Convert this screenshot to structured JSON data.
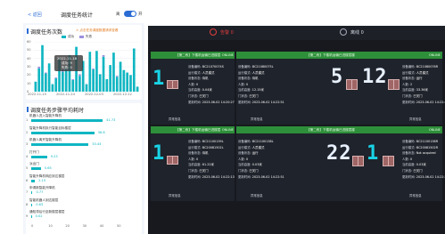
{
  "phone": {
    "back_label": "< 返回",
    "title": "调度任务统计",
    "toggle_on_label": "离",
    "toggle_off_label": "开",
    "section1": {
      "title": "调度任务次数",
      "note": "⚠ 点击任务调度数据请求查看",
      "legend": [
        {
          "label": "成功",
          "color": "#0fb6c2"
        },
        {
          "label": "失败",
          "color": "#9b8fe0"
        }
      ],
      "tooltip": {
        "date": "2022-11-18",
        "success": "成功: 9",
        "fail": "失败: 0"
      }
    },
    "section2": {
      "title": "调度任务步骤平均耗时"
    },
    "y_axis": [
      "60",
      "50",
      "40",
      "30",
      "20",
      "10",
      "0"
    ]
  },
  "chart_data": [
    {
      "type": "bar",
      "title": "调度任务次数",
      "x_tick_labels": [
        "2022-11-15",
        "2022-11-24",
        "2022-12-03",
        "2022-12-12"
      ],
      "ylim": [
        0,
        60
      ],
      "series": [
        {
          "name": "成功",
          "values": [
            12,
            28,
            56,
            22,
            34,
            9,
            16,
            40,
            24,
            30,
            44,
            14,
            54,
            19,
            37,
            9,
            48,
            27,
            49,
            21,
            42,
            15,
            32,
            47,
            18,
            36,
            26,
            23,
            20,
            52,
            6
          ]
        },
        {
          "name": "失败",
          "values": [
            0,
            2,
            0,
            1,
            0,
            0,
            1,
            0,
            3,
            0,
            0,
            1,
            0,
            2,
            0,
            0,
            0,
            1,
            0,
            0,
            2,
            0,
            0,
            0,
            1,
            0,
            0,
            0,
            0,
            0,
            0
          ]
        }
      ]
    },
    {
      "type": "bar",
      "title": "调度任务步骤平均耗时",
      "categories": [
        "机器人进入智能升降机",
        "智能升降机执行智能目标楼层",
        "机器人离开智能升降机",
        "打开门",
        "派出门",
        "智能升降机响应到达楼层",
        "申请新智能升降机",
        "智能机器人到达楼层",
        "通知滞后行至新楼层楼层"
      ],
      "values": [
        41.73,
        36.8,
        33.44,
        9.23,
        5.65,
        2.15,
        0.77,
        0.63,
        0.02
      ],
      "x_ticks": [
        "0",
        "10",
        "20",
        "30",
        "40",
        "50"
      ],
      "xlim": [
        0,
        50
      ]
    }
  ],
  "dash": {
    "alarm": "告警 0",
    "offline": "离线 0",
    "panels": [
      {
        "title": "【第二栋】下楼机运输已进楼层",
        "status": "ONLINE",
        "number": "1",
        "fields": [
          [
            "设备编码:",
            "BC21070074S"
          ],
          [
            "运行模式:",
            "人员模式"
          ],
          [
            "设备状态:",
            "待机"
          ],
          [
            "人数:",
            "0"
          ],
          [
            "当前高度:",
            "0.04米"
          ],
          [
            "门状态:",
            "已关门"
          ],
          [
            "更新时间:",
            "2023-06-02 14:20:27"
          ]
        ],
        "footer": "异常信息"
      },
      {
        "title": "【第二栋】下楼机运输已进楼层楼",
        "status": "ONLINE",
        "number_left": "5",
        "number_right": "12",
        "fields_left": [
          [
            "设备编码:",
            "BC21080075L"
          ],
          [
            "运行模式:",
            "人员模式"
          ],
          [
            "设备状态:",
            "待机"
          ],
          [
            "人数:",
            "0"
          ],
          [
            "当前高度:",
            "12.15米"
          ],
          [
            "门状态:",
            "已关门"
          ],
          [
            "更新时间:",
            "2023-06-02 14:22:51"
          ]
        ],
        "fields_right": [
          [
            "设备编码:",
            "BC21080076R"
          ],
          [
            "运行模式:",
            "人员模式"
          ],
          [
            "设备状态:",
            "运行"
          ],
          [
            "人数:",
            "2"
          ],
          [
            "当前高度:",
            "33.36米"
          ],
          [
            "门状态:",
            "已关门"
          ],
          [
            "更新时间:",
            "2023-06-02 14:22:41"
          ]
        ],
        "footer_left": "异常信息",
        "footer_right": "异常信息"
      },
      {
        "title": "【第二栋】下楼机运输已进楼层",
        "status": "ONLINE",
        "number": "1",
        "fields": [
          [
            "设备编码:",
            "BC21100139L"
          ],
          [
            "运行模式:",
            "BC20081502L"
          ],
          [
            "设备状态:",
            "待机"
          ],
          [
            "人数:",
            "0"
          ],
          [
            "当前高度:",
            "61.22米"
          ],
          [
            "门状态:",
            "已关门"
          ],
          [
            "更新时间:",
            "2023-06-02 14:22:13"
          ]
        ],
        "footer": "异常信息"
      },
      {
        "title": "【第二栋】下楼机运输已进楼层楼",
        "status": "ONLINE",
        "number_left": "22",
        "number_right": "1",
        "fields_left": [
          [
            "设备编码:",
            "BC21100138L"
          ],
          [
            "运行模式:",
            "人员模式"
          ],
          [
            "设备状态:",
            "运行"
          ],
          [
            "人数:",
            "0"
          ],
          [
            "当前高度:",
            "0.03米"
          ],
          [
            "门状态:",
            "已关门"
          ],
          [
            "更新时间:",
            "2023-06-02 14:22:51"
          ]
        ],
        "fields_right": [
          [
            "设备编码:",
            "BC21100138R"
          ],
          [
            "运行模式:",
            "BC20081502R"
          ],
          [
            "设备状态:",
            "Not acquired"
          ],
          [
            "人数:",
            "0"
          ],
          [
            "当前高度:",
            "0.03米"
          ],
          [
            "门状态:",
            "已关门"
          ],
          [
            "更新时间:",
            "2023-06-02 14:22:34"
          ]
        ],
        "footer_left": "异常信息",
        "footer_right": "异常信息"
      }
    ]
  }
}
